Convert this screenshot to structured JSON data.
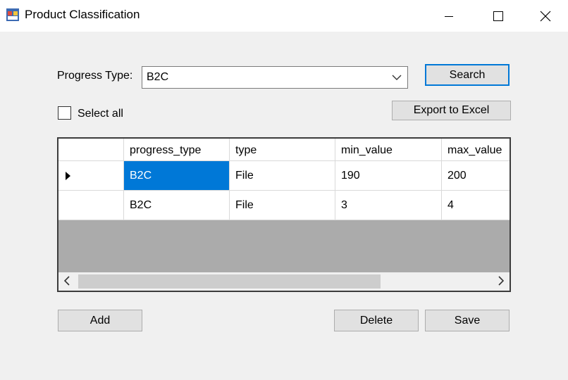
{
  "window": {
    "title": "Product Classification"
  },
  "form": {
    "progress_type_label": "Progress Type:",
    "progress_type_value": "B2C",
    "search_label": "Search",
    "select_all_label": "Select all",
    "export_label": "Export to Excel"
  },
  "grid": {
    "columns": [
      "progress_type",
      "type",
      "min_value",
      "max_value"
    ],
    "rows": [
      [
        "B2C",
        "File",
        "190",
        "200"
      ],
      [
        "B2C",
        "File",
        "3",
        "4"
      ]
    ]
  },
  "actions": {
    "add_label": "Add",
    "delete_label": "Delete",
    "save_label": "Save"
  },
  "colors": {
    "accent": "#0078d7",
    "grid_background": "#ababab",
    "window_background": "#f0f0f0"
  }
}
